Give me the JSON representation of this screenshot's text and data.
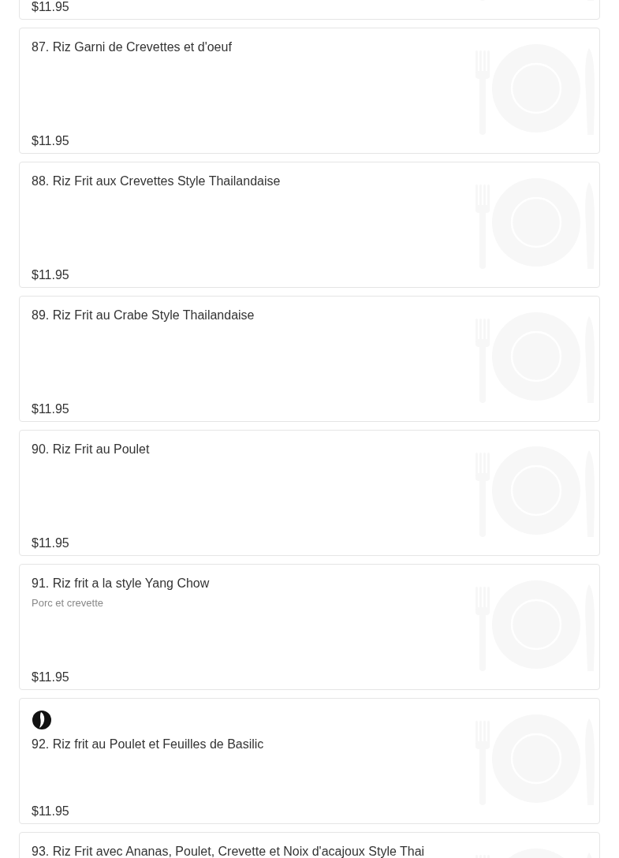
{
  "items": [
    {
      "price": "$11.95",
      "spicy": false
    },
    {
      "name": "87. Riz Garni de Crevettes et d'oeuf",
      "price": "$11.95",
      "spicy": false
    },
    {
      "name": "88. Riz Frit aux Crevettes Style Thailandaise",
      "price": "$11.95",
      "spicy": false
    },
    {
      "name": "89. Riz Frit au Crabe Style Thailandaise",
      "price": "$11.95",
      "spicy": false
    },
    {
      "name": "90. Riz Frit au Poulet",
      "price": "$11.95",
      "spicy": false
    },
    {
      "name": "91. Riz frit a la style Yang Chow",
      "description": "Porc et crevette",
      "price": "$11.95",
      "spicy": false
    },
    {
      "name": "92. Riz frit au Poulet et Feuilles de Basilic",
      "price": "$11.95",
      "spicy": true
    },
    {
      "name": "93. Riz Frit avec Ananas, Poulet, Crevette et Noix d'acajoux Style Thai",
      "spicy": false
    }
  ]
}
